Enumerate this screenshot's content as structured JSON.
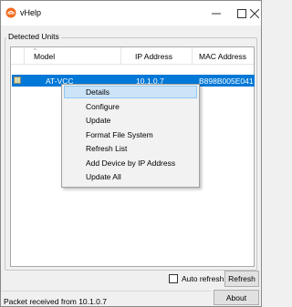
{
  "window": {
    "title": "vHelp",
    "app_icon": "vhelp-logo-icon",
    "controls": {
      "minimize": "minimize-icon",
      "maximize": "maximize-icon",
      "close": "close-icon"
    }
  },
  "group": {
    "label": "Detected Units"
  },
  "list": {
    "columns": [
      "Model",
      "IP Address",
      "MAC Address"
    ],
    "rows": [
      {
        "model": "AT-VCC",
        "ip": "10.1.0.7",
        "mac": "B898B005E041",
        "selected": true
      }
    ]
  },
  "context_menu": {
    "items": [
      "Details",
      "Configure",
      "Update",
      "Format File System",
      "Refresh List",
      "Add Device by IP Address",
      "Update All"
    ],
    "highlighted": "Details"
  },
  "controls": {
    "auto_refresh_label": "Auto refresh",
    "auto_refresh_checked": false,
    "refresh_label": "Refresh",
    "about_label": "About"
  },
  "status": {
    "text": "Packet received from 10.1.0.7"
  },
  "colors": {
    "selection": "#0078d7",
    "menu_hover": "#cce4f7",
    "app_icon": "#f26b21"
  }
}
